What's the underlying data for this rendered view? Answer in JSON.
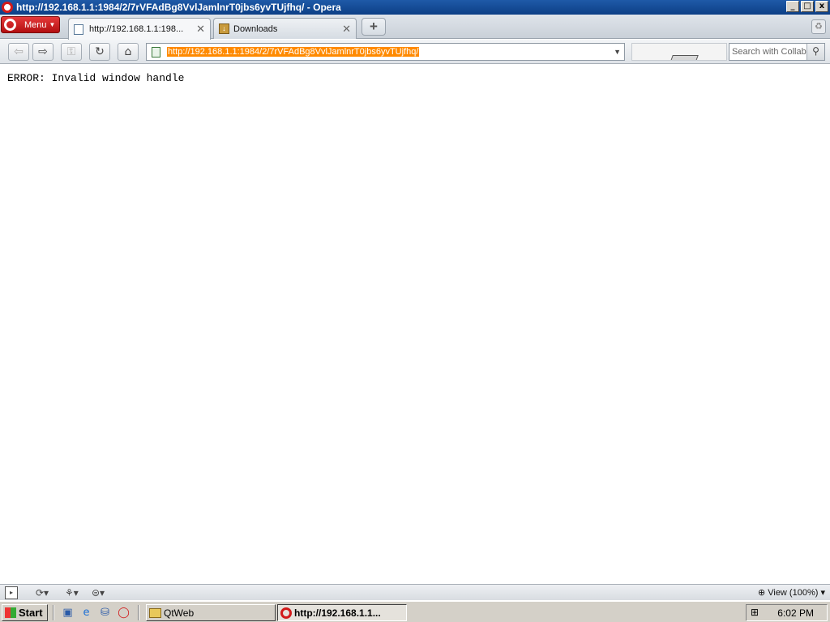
{
  "window": {
    "title": "http://192.168.1.1:1984/2/7rVFAdBg8VvlJamlnrT0jbs6yvTUjfhq/ - Opera",
    "controls": {
      "minimize": "_",
      "maximize": "□",
      "close": "x"
    }
  },
  "tabbar": {
    "menu_label": "Menu",
    "tabs": [
      {
        "label": "http://192.168.1.1:198...",
        "active": true,
        "icon": "page-icon"
      },
      {
        "label": "Downloads",
        "active": false,
        "icon": "download-icon"
      }
    ],
    "new_tab_glyph": "+",
    "trash_glyph": "♻"
  },
  "toolbar": {
    "back_glyph": "⇦",
    "forward_glyph": "⇨",
    "key_glyph": "⚿",
    "reload_glyph": "↻",
    "home_glyph": "⌂",
    "address_value": "http://192.168.1.1:1984/2/7rVFAdBg8VvlJamlnrT0jbs6yvTUjfhq/",
    "search_placeholder": "Search with Collab'",
    "search_glyph": "⚲"
  },
  "content": {
    "error_text": "ERROR: Invalid window handle"
  },
  "statusbar": {
    "panel_glyph": "▸",
    "sync_glyph": "⟳▾",
    "share_glyph": "⚘▾",
    "opera_glyph": "⊜▾",
    "zoom_label": "View (100%)"
  },
  "taskbar": {
    "start_label": "Start",
    "quick_launch": [
      "desktop-icon",
      "ie-icon",
      "network-icon",
      "opera-icon"
    ],
    "tasks": [
      {
        "label": "QtWeb",
        "pressed": false
      },
      {
        "label": "http://192.168.1.1...",
        "pressed": true
      }
    ],
    "clock": "6:02 PM"
  }
}
